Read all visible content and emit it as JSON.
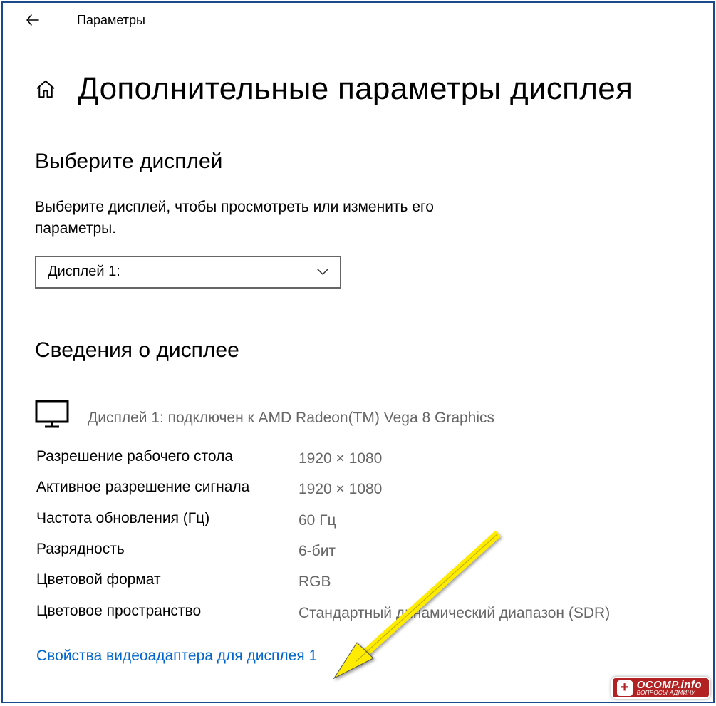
{
  "titlebar": {
    "title": "Параметры"
  },
  "page": {
    "title": "Дополнительные параметры дисплея"
  },
  "select_display": {
    "heading": "Выберите дисплей",
    "description": "Выберите дисплей, чтобы просмотреть или изменить его параметры.",
    "dropdown_value": "Дисплей 1:"
  },
  "display_info": {
    "heading": "Сведения о дисплее",
    "connected_text": "Дисплей 1: подключен к AMD Radeon(TM) Vega 8 Graphics",
    "props": [
      {
        "label": "Разрешение рабочего стола",
        "value": "1920 × 1080"
      },
      {
        "label": "Активное разрешение сигнала",
        "value": "1920 × 1080"
      },
      {
        "label": "Частота обновления (Гц)",
        "value": "60 Гц"
      },
      {
        "label": "Разрядность",
        "value": "6-бит"
      },
      {
        "label": "Цветовой формат",
        "value": "RGB"
      },
      {
        "label": "Цветовое пространство",
        "value": "Стандартный динамический диапазон (SDR)"
      }
    ],
    "adapter_link": "Свойства видеоадаптера для дисплея 1"
  },
  "watermark": {
    "main": "OCOMP.info",
    "sub": "ВОПРОСЫ АДМИНУ"
  }
}
